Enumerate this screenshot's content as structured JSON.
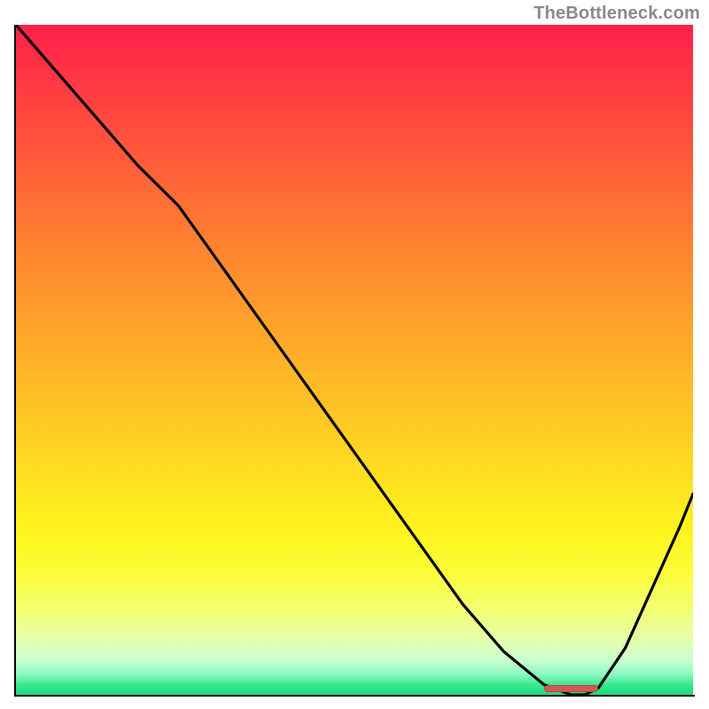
{
  "attribution": "TheBottleneck.com",
  "colors": {
    "gradient_top": "#ff1f4b",
    "gradient_bottom": "#1fd97e",
    "curve": "#000000",
    "marker": "#d05a54",
    "attribution_text": "#8a8a8a"
  },
  "chart_data": {
    "type": "line",
    "title": "",
    "xlabel": "",
    "ylabel": "",
    "xlim": [
      0,
      100
    ],
    "ylim": [
      0,
      100
    ],
    "note": "Axes are unlabeled in the image; x/y are normalized 0–100 to the plot box. y is plotted downward-from-top so higher y = lower on screen. The line starts at the top-left (y≈0), descends with a knee around x≈24, continues to a trough near x≈84 where y≈100 (the green band), then rises toward the right edge.",
    "series": [
      {
        "name": "bottleneck-curve",
        "x": [
          0,
          6,
          12,
          18,
          24,
          30,
          36,
          42,
          48,
          54,
          60,
          66,
          72,
          78,
          82,
          84,
          86,
          90,
          94,
          98,
          100
        ],
        "y": [
          0,
          7,
          14,
          21,
          27,
          35.5,
          44,
          52.5,
          61,
          69.5,
          78,
          86.5,
          93.5,
          98.5,
          100,
          100,
          99,
          93,
          84,
          75,
          70
        ]
      }
    ],
    "marker": {
      "name": "optimal-range",
      "x_start": 78,
      "x_end": 86,
      "y": 99.2
    }
  }
}
